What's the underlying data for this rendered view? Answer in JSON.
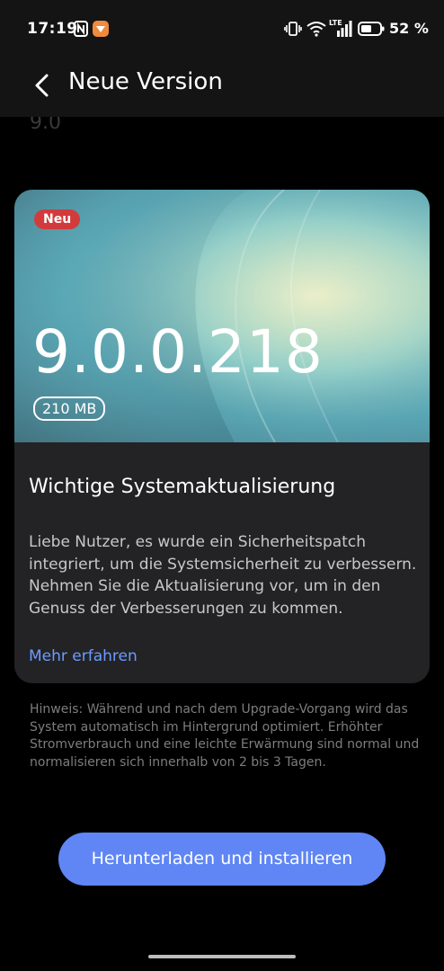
{
  "status_bar": {
    "time": "17:19",
    "battery_percent": "52 %",
    "network_label": "LTE",
    "icons": [
      "nfc-icon",
      "app-notification-icon",
      "vibrate-icon",
      "wifi-icon",
      "signal-icon",
      "battery-icon"
    ]
  },
  "app_bar": {
    "title": "Neue Version",
    "back_icon": "chevron-left-icon"
  },
  "ghost_text": "9.0",
  "update_card": {
    "badge": "Neu",
    "version": "9.0.0.218",
    "size": "210 MB",
    "title": "Wichtige Systemaktualisierung",
    "description": "Liebe Nutzer, es wurde ein Sicherheitspatch integriert, um die Systemsicherheit zu verbessern. Nehmen Sie die Aktualisierung vor, um in den Genuss der Verbesserungen zu kommen.",
    "learn_more": "Mehr erfahren"
  },
  "hint": "Hinweis: Während und nach dem Upgrade-Vorgang wird das System automatisch im Hintergrund optimiert. Erhöhter Stromverbrauch und eine leichte Erwärmung sind normal und normalisieren sich innerhalb von 2 bis 3 Tagen.",
  "action_button": "Herunterladen und installieren",
  "colors": {
    "accent": "#5f86f4",
    "link": "#6d9bff",
    "badge": "#d23b3b",
    "card": "#232325"
  }
}
